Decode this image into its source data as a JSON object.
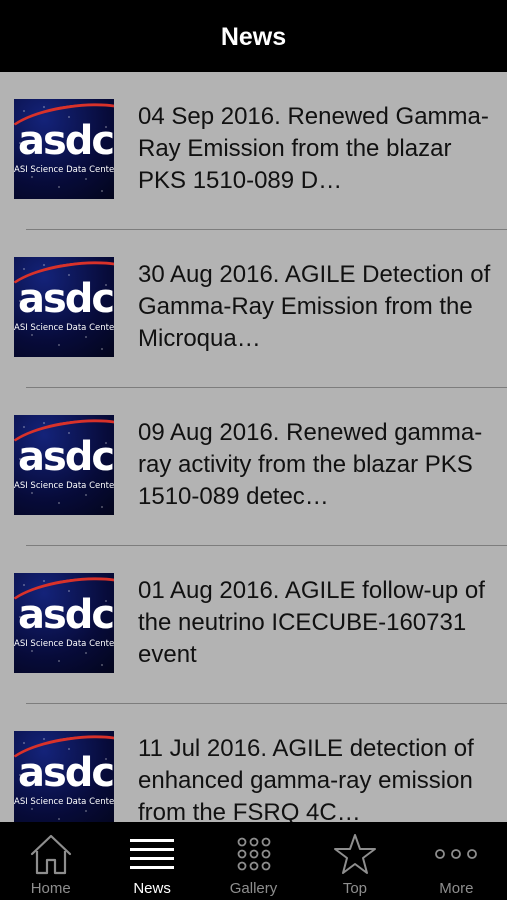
{
  "navbar": {
    "title": "News"
  },
  "thumb": {
    "logo_text": "asdc",
    "logo_subtitle": "ASI Science Data Center"
  },
  "news": [
    {
      "text": "04 Sep 2016. Renewed Gamma-Ray Emission from the blazar PKS 1510-089 D…"
    },
    {
      "text": "30 Aug 2016. AGILE Detection of Gamma-Ray Emission from the Microqua…"
    },
    {
      "text": "09 Aug 2016. Renewed gamma-ray activity from the blazar PKS 1510-089 detec…"
    },
    {
      "text": "01 Aug 2016. AGILE follow-up of the neutrino ICECUBE-160731 event"
    },
    {
      "text": "11 Jul 2016. AGILE detection of enhanced gamma-ray emission from the FSRQ 4C…"
    }
  ],
  "tabbar": {
    "tabs": [
      {
        "label": "Home",
        "icon": "home-icon"
      },
      {
        "label": "News",
        "icon": "list-icon",
        "active": true
      },
      {
        "label": "Gallery",
        "icon": "grid-icon"
      },
      {
        "label": "Top",
        "icon": "star-icon"
      },
      {
        "label": "More",
        "icon": "more-icon"
      }
    ]
  },
  "colors": {
    "bar_background": "#000000",
    "list_background": "#b3b3b3",
    "tab_active": "#ffffff",
    "tab_inactive": "#8e8e8e"
  }
}
